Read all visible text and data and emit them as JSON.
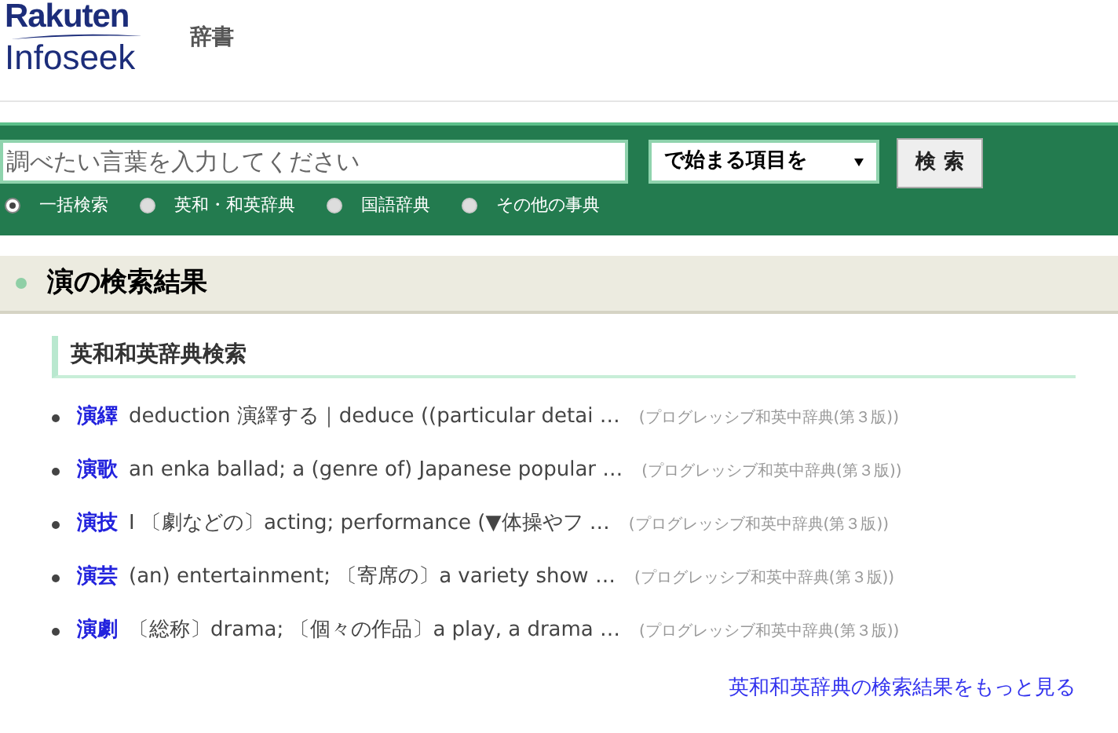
{
  "header": {
    "logo_top": "Rakuten",
    "logo_bottom": "Infoseek",
    "section": "辞書"
  },
  "search": {
    "placeholder": "調べたい言葉を入力してください",
    "mode": "で始まる項目を",
    "button": "検 索",
    "options": [
      {
        "label": "一括検索",
        "selected": true
      },
      {
        "label": "英和・和英辞典",
        "selected": false
      },
      {
        "label": "国語辞典",
        "selected": false
      },
      {
        "label": "その他の事典",
        "selected": false
      }
    ]
  },
  "results_title": "演の検索結果",
  "section_title": "英和和英辞典検索",
  "entries": [
    {
      "term": "演繹",
      "snippet": "deduction 演繹する｜deduce ((particular detai …",
      "source": "(プログレッシブ和英中辞典(第３版))"
    },
    {
      "term": "演歌",
      "snippet": "an enka ballad; a (genre of) Japanese popular …",
      "source": "(プログレッシブ和英中辞典(第３版))"
    },
    {
      "term": "演技",
      "snippet": "I 〔劇などの〕acting; performance (▼体操やフ …",
      "source": "(プログレッシブ和英中辞典(第３版))"
    },
    {
      "term": "演芸",
      "snippet": "(an) entertainment; 〔寄席の〕a variety show …",
      "source": "(プログレッシブ和英中辞典(第３版))"
    },
    {
      "term": "演劇",
      "snippet": "〔総称〕drama; 〔個々の作品〕a play, a drama …",
      "source": "(プログレッシブ和英中辞典(第３版))"
    }
  ],
  "more_link": "英和和英辞典の検索結果をもっと見る"
}
